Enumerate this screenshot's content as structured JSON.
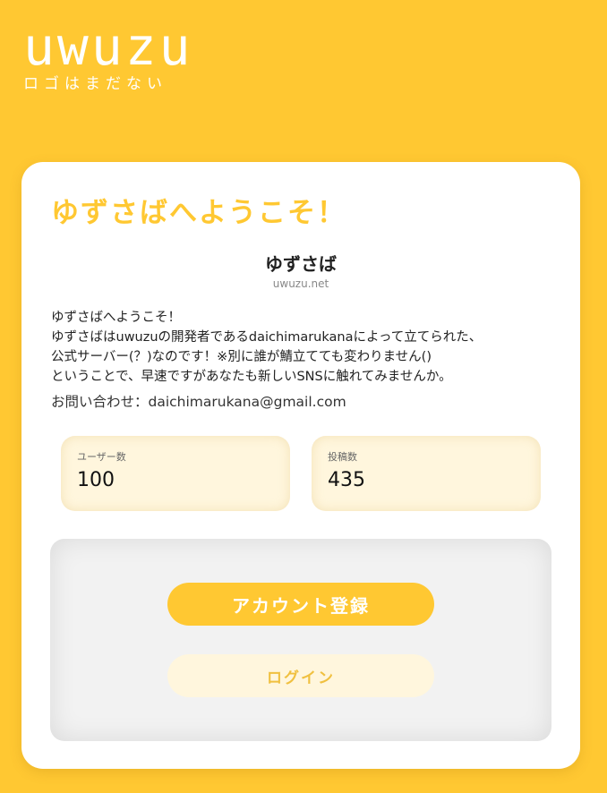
{
  "logo": {
    "text": "uwuzu",
    "subtitle": "ロゴはまだない"
  },
  "card": {
    "welcome_title": "ゆずさばへようこそ！",
    "server_name": "ゆずさば",
    "server_domain": "uwuzu.net",
    "description_lines": [
      "ゆずさばへようこそ！",
      "ゆずさばはuwuzuの開発者であるdaichimarukanaによって立てられた、",
      "公式サーバー(？)なのです！※別に誰が鯖立てても変わりません()",
      "ということで、早速ですがあなたも新しいSNSに触れてみませんか。"
    ],
    "contact": "お問い合わせ：daichimarukana@gmail.com"
  },
  "stats": {
    "users": {
      "label": "ユーザー数",
      "value": "100"
    },
    "posts": {
      "label": "投稿数",
      "value": "435"
    }
  },
  "actions": {
    "register_label": "アカウント登録",
    "login_label": "ログイン"
  },
  "colors": {
    "accent": "#FFC832",
    "accent_light": "#FFF6DD",
    "background": "#FFC832",
    "card": "#FFFFFF"
  }
}
